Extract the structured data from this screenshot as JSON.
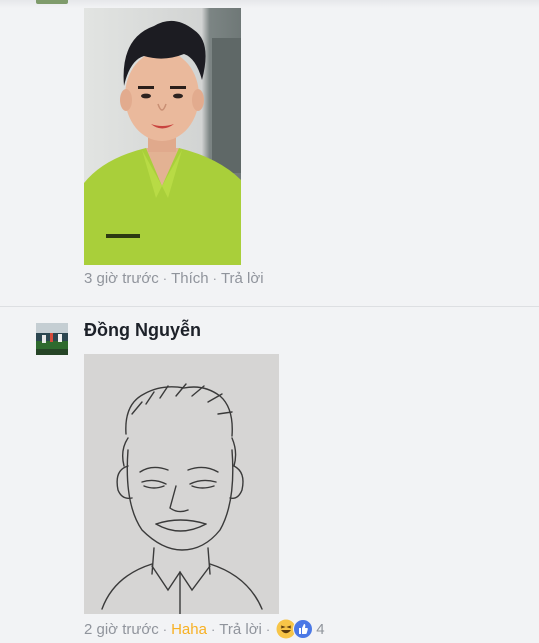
{
  "comments": [
    {
      "photo_alt": "selfie",
      "meta": {
        "time": "3 giờ trước",
        "like": "Thích",
        "reply": "Trả lời"
      }
    },
    {
      "author": "Đồng Nguyễn",
      "meta": {
        "time": "2 giờ trước",
        "reaction": "Haha",
        "reply": "Trả lời",
        "reaction_icons": [
          "haha-icon",
          "like-icon"
        ],
        "reaction_count": "4"
      }
    }
  ],
  "colors": {
    "background": "#f2f3f5",
    "meta_text": "#90949c",
    "haha_accent": "#f7b125",
    "like_blue": "#4b78e6",
    "author_text": "#1d2129"
  }
}
